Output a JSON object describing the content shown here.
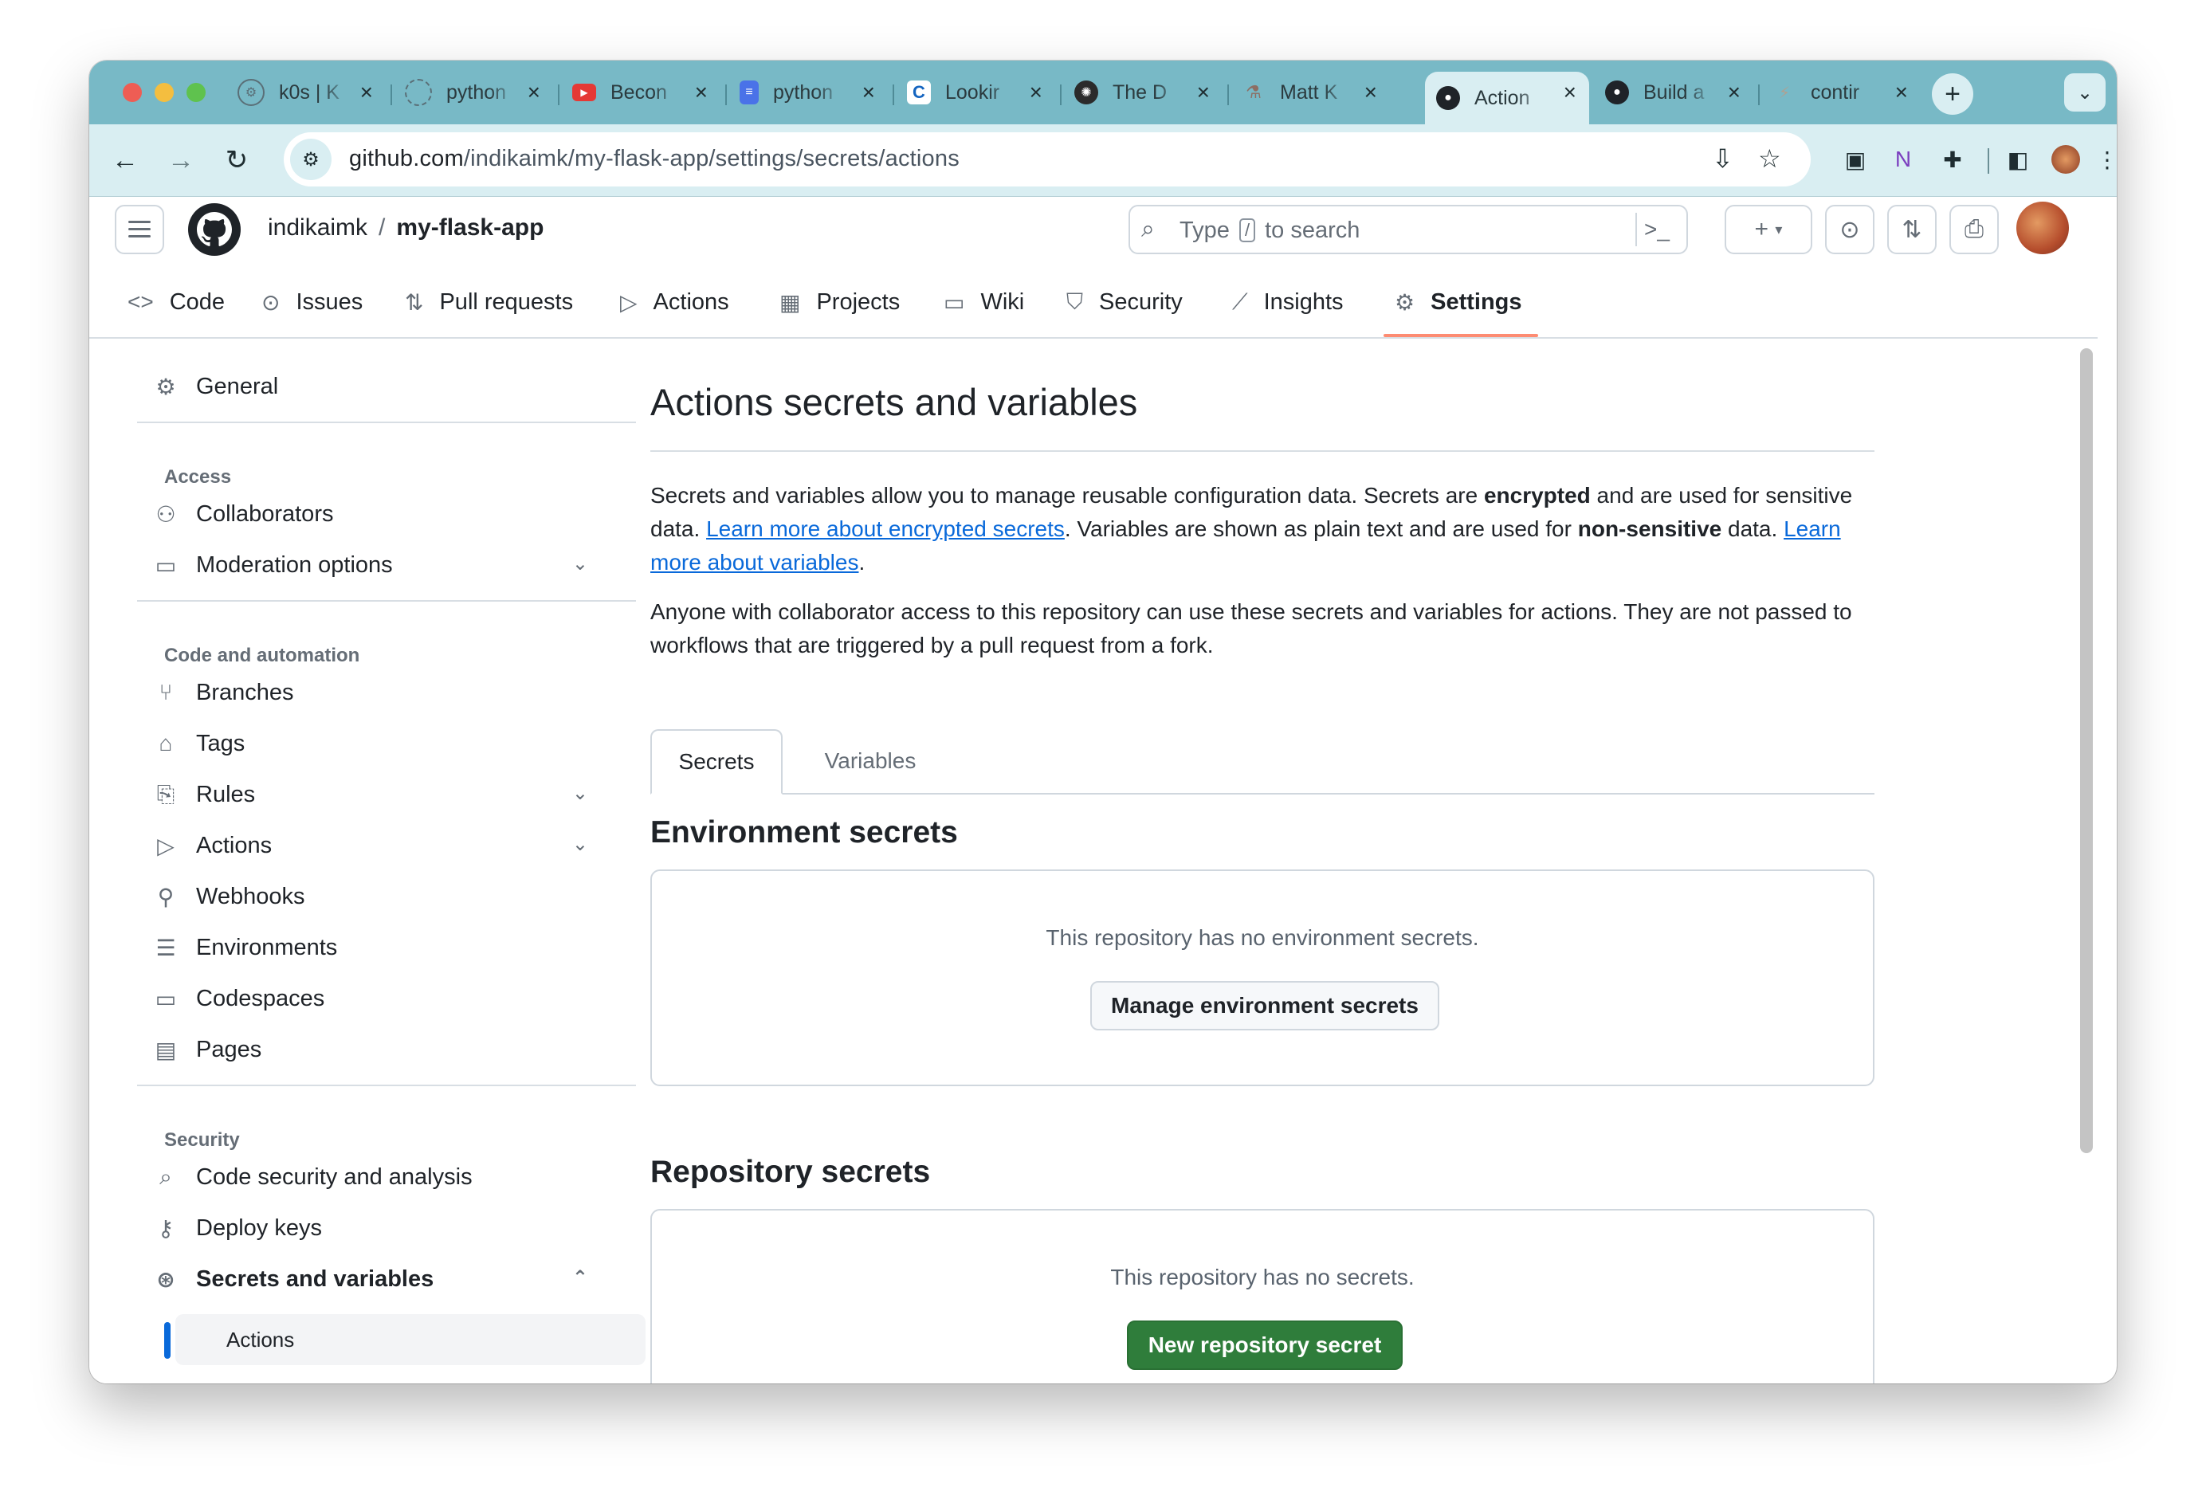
{
  "browser": {
    "tabs": [
      {
        "label": "k0s | K",
        "icon": "k0s-icon",
        "color": "#6a8ea0"
      },
      {
        "label": "python",
        "icon": "spinner-icon",
        "color": "#8aa8b0"
      },
      {
        "label": "Becon",
        "icon": "youtube-icon",
        "color": "#e53935"
      },
      {
        "label": "python",
        "icon": "docs-icon",
        "color": "#4a72e8"
      },
      {
        "label": "Lookir",
        "icon": "coursera-icon",
        "color": "#1565c0"
      },
      {
        "label": "The D",
        "icon": "chatgpt-icon",
        "color": "#2b2b2b"
      },
      {
        "label": "Matt K",
        "icon": "flask-icon",
        "color": "#8d6e63"
      },
      {
        "label": "Action",
        "icon": "github-icon",
        "color": "#1f2328"
      },
      {
        "label": "Build a",
        "icon": "github-icon",
        "color": "#1f2328"
      },
      {
        "label": "contir",
        "icon": "gitlab-icon",
        "color": "#a0a0a0"
      }
    ],
    "url_host": "github.com",
    "url_path": "/indikaimk/my-flask-app/settings/secrets/actions"
  },
  "header": {
    "owner": "indikaimk",
    "separator": "/",
    "repo": "my-flask-app",
    "search_prefix": "Type",
    "search_key": "/",
    "search_suffix": "to search"
  },
  "repo_nav": {
    "code": "Code",
    "issues": "Issues",
    "pull_requests": "Pull requests",
    "actions": "Actions",
    "projects": "Projects",
    "wiki": "Wiki",
    "security": "Security",
    "insights": "Insights",
    "settings": "Settings"
  },
  "sidebar": {
    "general": "General",
    "access_heading": "Access",
    "collaborators": "Collaborators",
    "moderation": "Moderation options",
    "code_heading": "Code and automation",
    "branches": "Branches",
    "tags": "Tags",
    "rules": "Rules",
    "actions": "Actions",
    "webhooks": "Webhooks",
    "environments": "Environments",
    "codespaces": "Codespaces",
    "pages": "Pages",
    "security_heading": "Security",
    "code_security": "Code security and analysis",
    "deploy_keys": "Deploy keys",
    "secrets_vars": "Secrets and variables",
    "sub_actions": "Actions"
  },
  "main": {
    "title": "Actions secrets and variables",
    "p1_a": "Secrets and variables allow you to manage reusable configuration data. Secrets are ",
    "p1_bold1": "encrypted",
    "p1_b": " and are used for sensitive data. ",
    "p1_link1": "Learn more about encrypted secrets",
    "p1_c": ". Variables are shown as plain text and are used for ",
    "p1_bold2": "non-sensitive",
    "p1_d": " data. ",
    "p1_link2": "Learn more about variables",
    "p1_e": ".",
    "p2": "Anyone with collaborator access to this repository can use these secrets and variables for actions. They are not passed to workflows that are triggered by a pull request from a fork.",
    "tab_secrets": "Secrets",
    "tab_variables": "Variables",
    "env_title": "Environment secrets",
    "env_empty": "This repository has no environment secrets.",
    "env_button": "Manage environment secrets",
    "repo_title": "Repository secrets",
    "repo_empty": "This repository has no secrets.",
    "repo_button": "New repository secret"
  },
  "colors": {
    "tabstrip": "#78b9c6",
    "toolbar": "#d9eef2",
    "link": "#0969da",
    "primary_button": "#2f7d3b",
    "active_indicator": "#fd8c73"
  }
}
